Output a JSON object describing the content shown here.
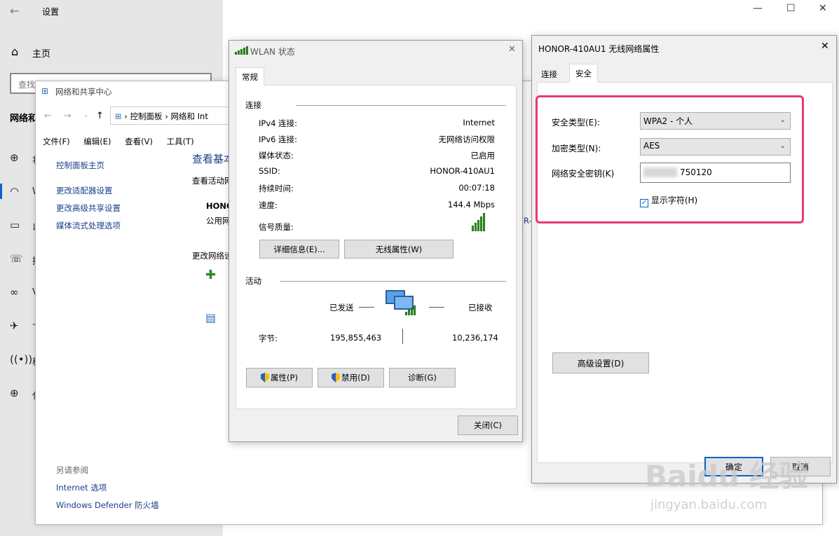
{
  "settings": {
    "title": "设置",
    "home": "主页",
    "search_placeholder": "查找设置",
    "section": "网络和",
    "nav_letters": [
      "状",
      "W",
      "以",
      "拨",
      "V",
      "飞",
      "移",
      "代"
    ]
  },
  "control_panel": {
    "title": "网络和共享中心",
    "address_parts": [
      "控制面板",
      "网络和 Int"
    ],
    "menu": [
      "文件(F)",
      "编辑(E)",
      "查看(V)",
      "工具(T)"
    ],
    "side_links": [
      "控制面板主页",
      "更改适配器设置",
      "更改高级共享设置",
      "媒体流式处理选项"
    ],
    "heading": "查看基本",
    "active_label": "查看活动网",
    "network_name": "HONO",
    "network_type": "公用网",
    "change_label": "更改网络设",
    "see_also": "另请参阅",
    "bottom_links": [
      "Internet 选项",
      "Windows Defender 防火墙"
    ],
    "link_fragment": "R-4"
  },
  "wlan": {
    "title": "WLAN 状态",
    "tab": "常规",
    "conn_group": "连接",
    "rows": [
      {
        "label": "IPv4 连接:",
        "value": "Internet"
      },
      {
        "label": "IPv6 连接:",
        "value": "无网络访问权限"
      },
      {
        "label": "媒体状态:",
        "value": "已启用"
      },
      {
        "label": "SSID:",
        "value": "HONOR-410AU1"
      },
      {
        "label": "持续时间:",
        "value": "00:07:18"
      },
      {
        "label": "速度:",
        "value": "144.4 Mbps"
      }
    ],
    "signal_label": "信号质量:",
    "details_button": "详细信息(E)...",
    "wireless_button": "无线属性(W)",
    "activity_group": "活动",
    "sent_label": "已发送",
    "received_label": "已接收",
    "bytes_label": "字节:",
    "sent_bytes": "195,855,463",
    "received_bytes": "10,236,174",
    "properties_button": "属性(P)",
    "disable_button": "禁用(D)",
    "diagnose_button": "诊断(G)",
    "close_button": "关闭(C)"
  },
  "props": {
    "title": "HONOR-410AU1 无线网络属性",
    "tabs": [
      "连接",
      "安全"
    ],
    "security_type_label": "安全类型(E):",
    "security_type_value": "WPA2 - 个人",
    "encryption_label": "加密类型(N):",
    "encryption_value": "AES",
    "key_label": "网络安全密钥(K)",
    "key_value": "750120",
    "show_chars_label": "显示字符(H)",
    "advanced_button": "高级设置(D)",
    "ok_button": "确定",
    "cancel_button": "取消"
  },
  "watermark": {
    "main": "Baidu 经验",
    "sub": "jingyan.baidu.com"
  },
  "colors": {
    "highlight": "#e73b6c",
    "accent": "#0a64c8",
    "link": "#1a3e8c"
  }
}
